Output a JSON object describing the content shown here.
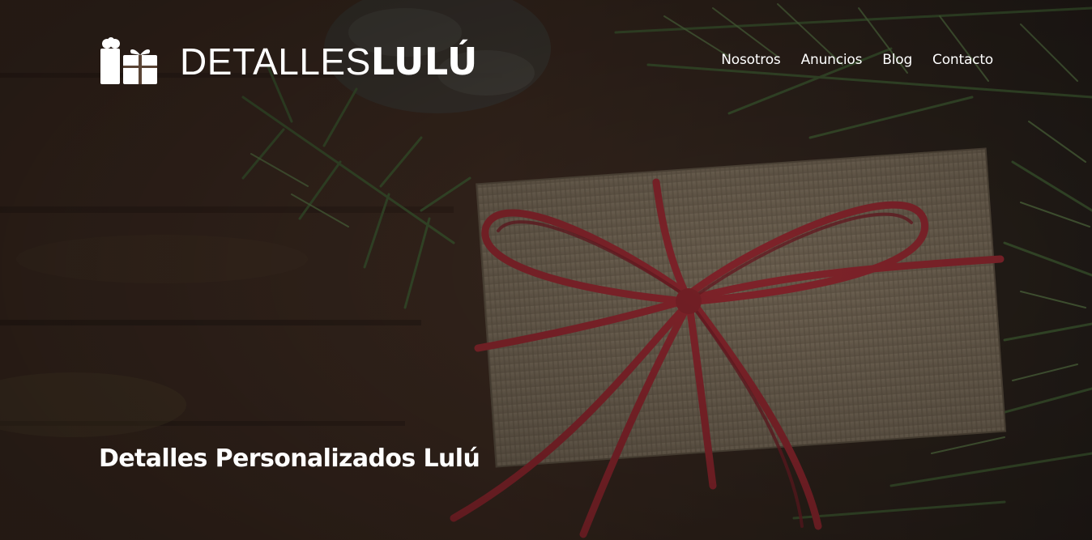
{
  "brand": {
    "name_light": "DETALLES",
    "name_bold": "LULÚ",
    "logo_icon": "gift-icon"
  },
  "nav": {
    "items": [
      {
        "label": "Nosotros"
      },
      {
        "label": "Anuncios"
      },
      {
        "label": "Blog"
      },
      {
        "label": "Contacto"
      }
    ]
  },
  "hero": {
    "title": "Detalles Personalizados Lulú",
    "background": "gift-on-pine-branches-photo"
  },
  "colors": {
    "text": "#ffffff",
    "ribbon": "#b0313a",
    "kraft": "#8f7f6a",
    "pine": "#3e5a35",
    "wood": "#4a3426"
  }
}
